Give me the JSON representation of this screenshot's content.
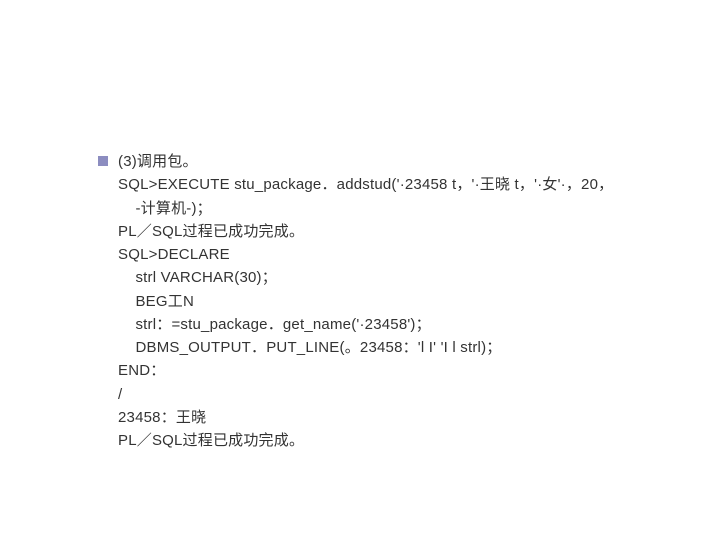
{
  "slide": {
    "lines": [
      "(3)调用包。",
      "SQL>EXECUTE stu_package．addstud('·23458 t，'·王晓 t，'·女'·，20，",
      "    -计算机-)；",
      "PL／SQL过程已成功完成。",
      "SQL>DECLARE",
      "    strl VARCHAR(30)；",
      "    BEG工N",
      "    strl：=stu_package．get_name('·23458')；",
      "    DBMS_OUTPUT．PUT_LINE(。23458：'l I' 'I l strl)；",
      "END：",
      "/",
      "23458：王晓",
      "PL／SQL过程已成功完成。"
    ]
  }
}
